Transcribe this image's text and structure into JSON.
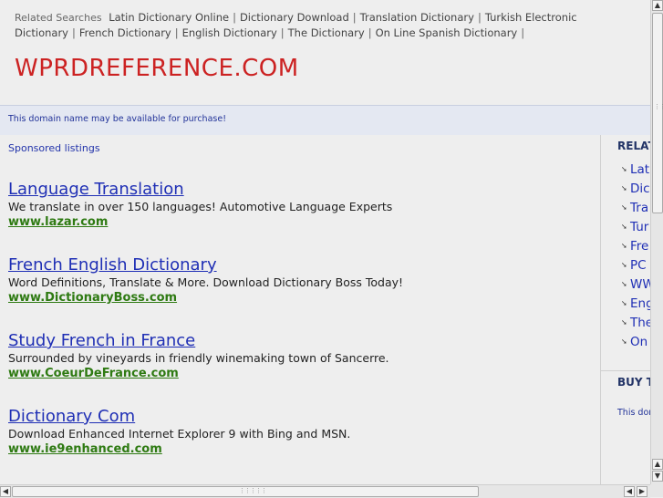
{
  "related_top": {
    "label": "Related Searches",
    "links": [
      "Latin Dictionary Online",
      "Dictionary Download",
      "Translation Dictionary",
      "Turkish Electronic Dictionary",
      "French Dictionary",
      "English Dictionary",
      "The Dictionary",
      "On Line Spanish Dictionary"
    ]
  },
  "site_title": "WPRDREFERENCE.COM",
  "domain_notice": "This domain name may be available for purchase!",
  "sponsored_label": "Sponsored listings",
  "listings": [
    {
      "title": "Language Translation",
      "desc": "We translate in over 150 languages! Automotive Language Experts",
      "url": "www.lazar.com"
    },
    {
      "title": "French English Dictionary",
      "desc": "Word Definitions, Translate & More. Download Dictionary Boss Today!",
      "url": "www.DictionaryBoss.com"
    },
    {
      "title": "Study French in France",
      "desc": "Surrounded by vineyards in friendly winemaking town of Sancerre.",
      "url": "www.CoeurDeFrance.com"
    },
    {
      "title": "Dictionary Com",
      "desc": "Download Enhanced Internet Explorer 9 with Bing and MSN.",
      "url": "www.ie9enhanced.com"
    }
  ],
  "sidebar": {
    "heading": "RELAT",
    "items": [
      "Lati",
      "Dic",
      "Tra",
      "Tur",
      "Fre",
      "PC",
      "WW",
      "Eng",
      "The",
      "On"
    ],
    "buy_heading": "BUY T",
    "buy_text": "This dor"
  },
  "icons": {
    "list_bullet": "arrow-icon",
    "scroll_up": "scroll-up-icon",
    "scroll_down": "scroll-down-icon",
    "scroll_left": "scroll-left-icon",
    "scroll_right": "scroll-right-icon"
  },
  "colors": {
    "site_title": "#cc2222",
    "link_title": "#1f2fb5",
    "link_url": "#2e7a12",
    "domain_bar_bg": "#e4e8f2"
  }
}
